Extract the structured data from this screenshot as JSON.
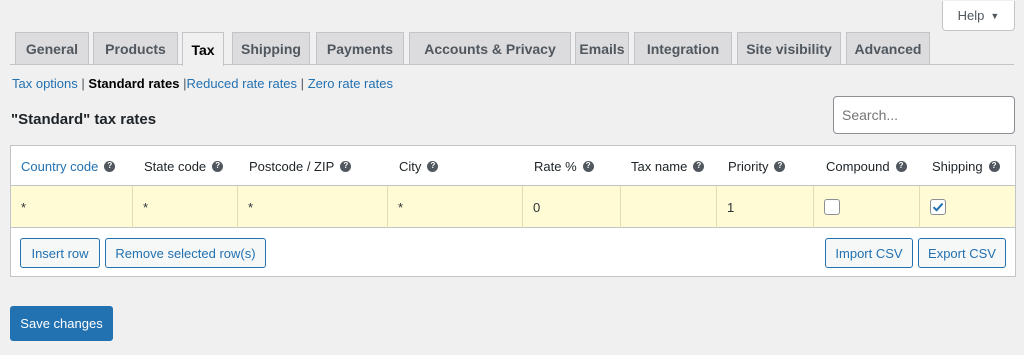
{
  "help": {
    "label": "Help",
    "caret": "▼"
  },
  "tabs": [
    {
      "label": "General"
    },
    {
      "label": "Products"
    },
    {
      "label": "Tax",
      "active": true
    },
    {
      "label": "Shipping"
    },
    {
      "label": "Payments"
    },
    {
      "label": "Accounts & Privacy"
    },
    {
      "label": "Emails"
    },
    {
      "label": "Integration"
    },
    {
      "label": "Site visibility"
    },
    {
      "label": "Advanced"
    }
  ],
  "subnav": {
    "tax_options": "Tax options",
    "sep": "|",
    "standard_rates": "Standard rates",
    "reduced_rates": "Reduced rate rates",
    "zero_rates": "Zero rate rates"
  },
  "section_title": "\"Standard\" tax rates",
  "search": {
    "placeholder": "Search..."
  },
  "table": {
    "columns": [
      "Country code",
      "State code",
      "Postcode / ZIP",
      "City",
      "Rate %",
      "Tax name",
      "Priority",
      "Compound",
      "Shipping"
    ],
    "help_glyph": "?",
    "rows": [
      {
        "country": "*",
        "state": "*",
        "postcode": "*",
        "city": "*",
        "rate": "0",
        "tax_name": "",
        "priority": "1",
        "compound": false,
        "shipping": true
      }
    ]
  },
  "buttons": {
    "insert_row": "Insert row",
    "remove_rows": "Remove selected row(s)",
    "import_csv": "Import CSV",
    "export_csv": "Export CSV",
    "save": "Save changes"
  },
  "colors": {
    "accent": "#2271b1",
    "row_highlight": "#fefbd5"
  }
}
